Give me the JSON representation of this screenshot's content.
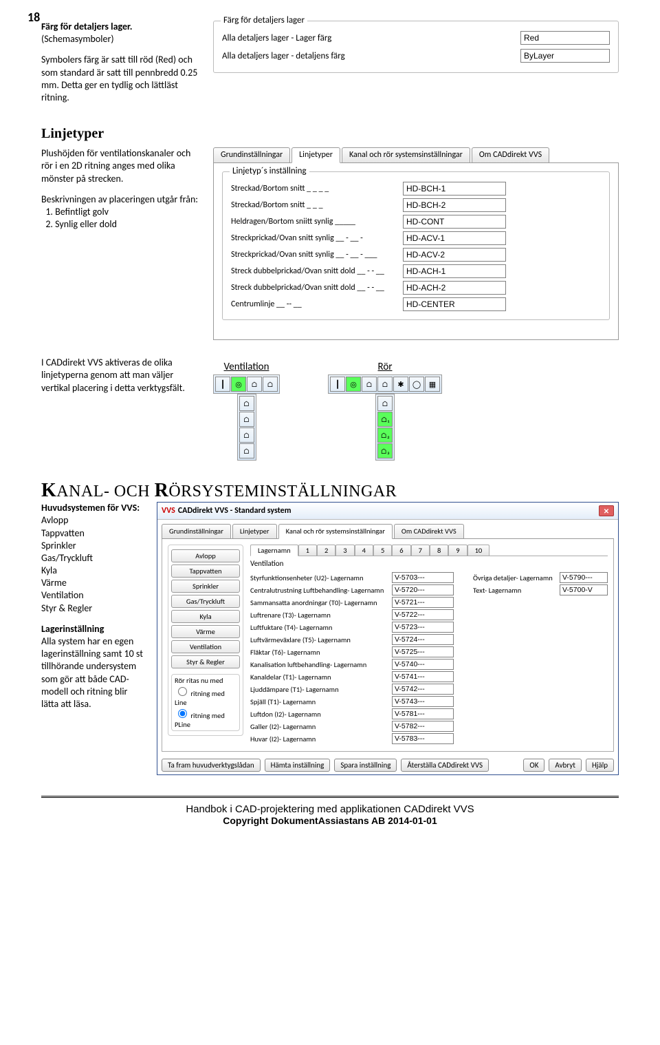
{
  "page": {
    "number": "18"
  },
  "section1": {
    "title": "Färg för detaljers lager.",
    "subtitle": "(Schemasymboler)",
    "body": "Symbolers färg är satt till röd (Red) och som standard är satt till pennbredd 0.25 mm. Detta ger en tydlig och lättläst ritning."
  },
  "colorBox": {
    "legend": "Färg för detaljers lager",
    "rows": [
      {
        "label": "Alla detaljers lager - Lager färg",
        "value": "Red"
      },
      {
        "label": "Alla detaljers lager - detaljens färg",
        "value": "ByLayer"
      }
    ]
  },
  "section2": {
    "heading": "Linjetyper",
    "p1": "Plushöjden för ventilations­kanaler och rör i en 2D ritning anges med olika mönster på strecken.",
    "p2lead": "Beskrivningen av placeringen utgår från:",
    "items": [
      "Befintligt golv",
      "Synlig eller dold"
    ]
  },
  "linetypes": {
    "tabs": [
      "Grundinställningar",
      "Linjetyper",
      "Kanal och rör systemsinställningar",
      "Om CADdirekt VVS"
    ],
    "legend": "Linjetyp´s inställning",
    "rows": [
      {
        "name": "Streckad/Bortom snitt _ _ _ _",
        "val": "HD-BCH-1"
      },
      {
        "name": "Streckad/Bortom snitt _ _ _",
        "val": "HD-BCH-2"
      },
      {
        "name": "Heldragen/Bortom sniitt synlig _____",
        "val": "HD-CONT"
      },
      {
        "name": "Streckprickad/Ovan snitt synlig __ - __ -",
        "val": "HD-ACV-1"
      },
      {
        "name": "Streckprickad/Ovan snitt synlig __ - __ - ___",
        "val": "HD-ACV-2"
      },
      {
        "name": "Streck dubbelprickad/Ovan snitt dold __ - - __",
        "val": "HD-ACH-1"
      },
      {
        "name": "Streck dubbelprickad/Ovan snitt dold __ - - __",
        "val": "HD-ACH-2"
      },
      {
        "name": "Centrumlinje __ -- __",
        "val": "HD-CENTER"
      }
    ]
  },
  "toolbars": {
    "explain": "I CADdirekt VVS aktiveras de olika linjetyperna genom att man väljer vertikal placering i detta verktygsfält.",
    "vent": {
      "label": "Ventilation"
    },
    "ror": {
      "label": "Rör"
    }
  },
  "section3": {
    "headingParts": [
      "K",
      "ANAL- OCH ",
      "R",
      "ÖRSYSTEMINSTÄLLNINGAR"
    ],
    "subhead": "Huvudsystemen för VVS:",
    "systems": [
      "Avlopp",
      "Tappvatten",
      "Sprinkler",
      "Gas/Tryckluft",
      "Kyla",
      "Värme",
      "Ventilation",
      "Styr & Regler"
    ],
    "p2head": "Lagerinställning",
    "p2body": "Alla system har en egen lagerinställning samt 10 st tillhörande undersystem som gör att både CAD-modell och ritning blir lätta att läsa."
  },
  "dialog": {
    "title": "CADdirekt VVS - Standard system",
    "tabs": [
      "Grundinställningar",
      "Linjetyper",
      "Kanal och rör systemsinställningar",
      "Om CADdirekt VVS"
    ],
    "leftButtons": [
      "Avlopp",
      "Tappvatten",
      "Sprinkler",
      "Gas/Tryckluft",
      "Kyla",
      "Värme",
      "Ventilation",
      "Styr & Regler"
    ],
    "radioLegend": "Rör ritas nu med",
    "radios": [
      "ritning med Line",
      "ritning med PLine"
    ],
    "minitabs": [
      "Lagernamn",
      "1",
      "2",
      "3",
      "4",
      "5",
      "6",
      "7",
      "8",
      "9",
      "10"
    ],
    "panelTitle": "Ventilation",
    "rows": [
      {
        "label": "Styrfunktionsenheter (U2)- Lagernamn",
        "val": "V-5703---"
      },
      {
        "label": "Centralutrustning Luftbehandling- Lagernamn",
        "val": "V-5720---"
      },
      {
        "label": "Sammansatta anordningar (T0)- Lagernamn",
        "val": "V-5721---"
      },
      {
        "label": "Luftrenare (T3)- Lagernamn",
        "val": "V-5722---"
      },
      {
        "label": "Luftfuktare (T4)- Lagernamn",
        "val": "V-5723---"
      },
      {
        "label": "Luftvärmeväxlare (T5)- Lagernamn",
        "val": "V-5724---"
      },
      {
        "label": "Fläktar (T6)- Lagernamn",
        "val": "V-5725---"
      },
      {
        "label": "Kanalisation luftbehandling- Lagernamn",
        "val": "V-5740---"
      },
      {
        "label": "Kanaldelar (T1)- Lagernamn",
        "val": "V-5741---"
      },
      {
        "label": "Ljuddämpare (T1)- Lagernamn",
        "val": "V-5742---"
      },
      {
        "label": "Spjäll (T1)- Lagernamn",
        "val": "V-5743---"
      },
      {
        "label": "Luftdon (I2)- Lagernamn",
        "val": "V-5781---"
      },
      {
        "label": "Galler (I2)- Lagernamn",
        "val": "V-5782---"
      },
      {
        "label": "Huvar (I2)- Lagernamn",
        "val": "V-5783---"
      }
    ],
    "rightRows": [
      {
        "label": "Övriga detaljer- Lagernamn",
        "val": "V-5790---"
      },
      {
        "label": "Text- Lagernamn",
        "val": "V-5700-V"
      }
    ],
    "buttons": [
      "Ta fram huvudverktygslådan",
      "Hämta inställning",
      "Spara inställning",
      "Återställa CADdirekt VVS",
      "OK",
      "Avbryt",
      "Hjälp"
    ]
  },
  "footer": {
    "line1": "Handbok i CAD-projektering med applikationen CADdirekt VVS",
    "line2": "Copyright DokumentAssiastans AB 2014-01-01"
  }
}
